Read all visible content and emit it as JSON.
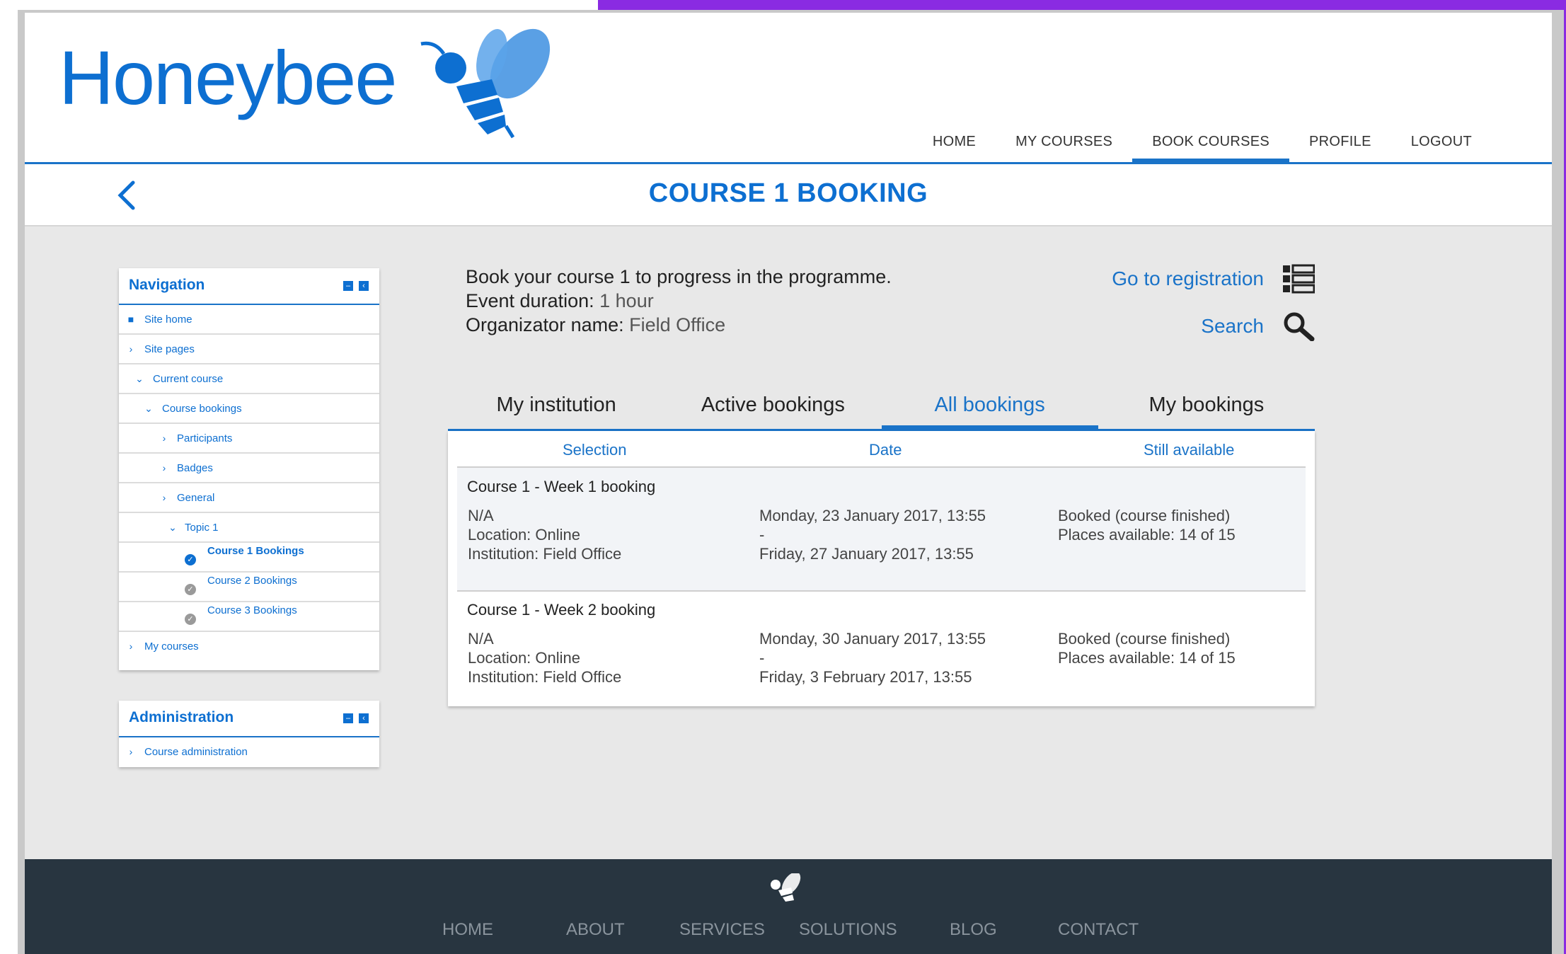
{
  "brand": {
    "name": "Honeybee"
  },
  "main_nav": [
    "HOME",
    "MY COURSES",
    "BOOK COURSES",
    "PROFILE",
    "LOGOUT"
  ],
  "active_nav": "BOOK COURSES",
  "page_title": "COURSE 1 BOOKING",
  "navigation_block": {
    "title": "Navigation",
    "items": [
      {
        "label": "Site home"
      },
      {
        "label": "Site pages"
      },
      {
        "label": "Current course"
      },
      {
        "label": "Course bookings"
      },
      {
        "label": "Participants"
      },
      {
        "label": "Badges"
      },
      {
        "label": "General"
      },
      {
        "label": "Topic 1"
      },
      {
        "label": "Course 1 Bookings"
      },
      {
        "label": "Course 2 Bookings"
      },
      {
        "label": "Course 3 Bookings"
      },
      {
        "label": "My courses"
      }
    ]
  },
  "admin_block": {
    "title": "Administration",
    "items": [
      {
        "label": "Course administration"
      }
    ]
  },
  "info": {
    "description": "Book your course 1 to progress in the programme.",
    "duration_label": "Event duration:",
    "duration_value": "1 hour",
    "organizer_label": "Organizator name:",
    "organizer_value": "Field Office"
  },
  "links": {
    "registration": "Go to registration",
    "search": "Search"
  },
  "tabs": [
    "My institution",
    "Active bookings",
    "All bookings",
    "My bookings"
  ],
  "active_tab": "All bookings",
  "table": {
    "headers": [
      "Selection",
      "Date",
      "Still available"
    ],
    "rows": [
      {
        "title": "Course 1 - Week 1 booking",
        "selection": [
          "N/A",
          "Location: Online",
          "Institution: Field Office"
        ],
        "date": [
          "Monday, 23 January 2017, 13:55",
          "-",
          "Friday, 27 January 2017, 13:55"
        ],
        "available": [
          "Booked (course finished)",
          "Places available: 14 of 15"
        ]
      },
      {
        "title": "Course 1 - Week 2 booking",
        "selection": [
          "N/A",
          "Location: Online",
          "Institution: Field Office"
        ],
        "date": [
          "Monday, 30 January 2017, 13:55",
          "-",
          "Friday, 3 February 2017, 13:55"
        ],
        "available": [
          "Booked (course finished)",
          "Places available: 14 of 15"
        ]
      }
    ]
  },
  "footer_nav": [
    "HOME",
    "ABOUT",
    "SERVICES",
    "SOLUTIONS",
    "BLOG",
    "CONTACT"
  ],
  "colors": {
    "brand_blue": "#0d6fd1",
    "accent_purple": "#8a2be2",
    "footer_bg": "#283540"
  }
}
